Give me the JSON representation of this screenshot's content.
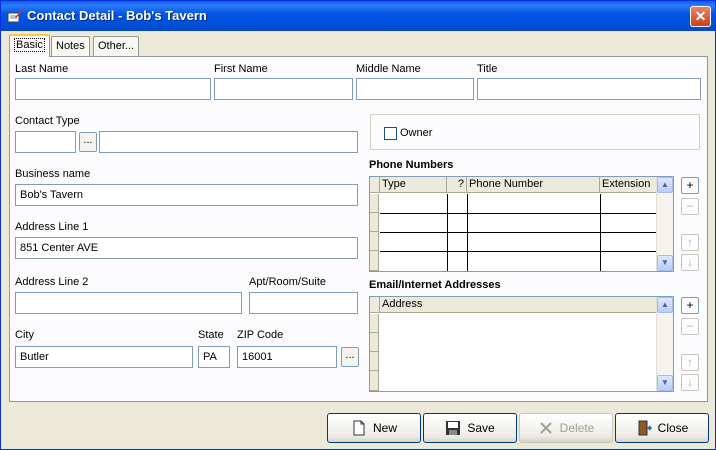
{
  "window": {
    "title": "Contact Detail - Bob's Tavern",
    "close_glyph": "✕"
  },
  "tabs": [
    {
      "label": "Basic",
      "active": true
    },
    {
      "label": "Notes"
    },
    {
      "label": "Other..."
    }
  ],
  "form": {
    "last_name": {
      "label": "Last Name",
      "value": ""
    },
    "first_name": {
      "label": "First Name",
      "value": ""
    },
    "middle_name": {
      "label": "Middle Name",
      "value": ""
    },
    "title": {
      "label": "Title",
      "value": ""
    },
    "contact_type": {
      "label": "Contact Type",
      "code": "",
      "description": "",
      "browse": "..."
    },
    "owner": {
      "label": "Owner",
      "checked": false
    },
    "business_name": {
      "label": "Business name",
      "value": "Bob's Tavern"
    },
    "address1": {
      "label": "Address Line 1",
      "value": "851 Center AVE"
    },
    "address2": {
      "label": "Address Line 2",
      "value": ""
    },
    "apt": {
      "label": "Apt/Room/Suite",
      "value": ""
    },
    "city": {
      "label": "City",
      "value": "Butler"
    },
    "state": {
      "label": "State",
      "value": "PA"
    },
    "zip": {
      "label": "ZIP Code",
      "value": "16001",
      "browse": "..."
    }
  },
  "phone_numbers": {
    "heading": "Phone Numbers",
    "columns": [
      "Type",
      "?",
      "Phone Number",
      "Extension"
    ],
    "rows": 4
  },
  "email_addresses": {
    "heading": "Email/Internet Addresses",
    "columns": [
      "Address"
    ],
    "rows": 4
  },
  "side_buttons": {
    "add": "+",
    "remove": "−",
    "up": "↑",
    "down": "↓"
  },
  "scroll": {
    "up": "▲",
    "down": "▼"
  },
  "buttons": {
    "new": "New",
    "save": "Save",
    "delete": "Delete",
    "close": "Close"
  },
  "colors": {
    "titlebar": "#0054E3",
    "panel": "#FCFCFE",
    "dialog": "#ECE9D8",
    "field_border": "#7F9DB9"
  }
}
